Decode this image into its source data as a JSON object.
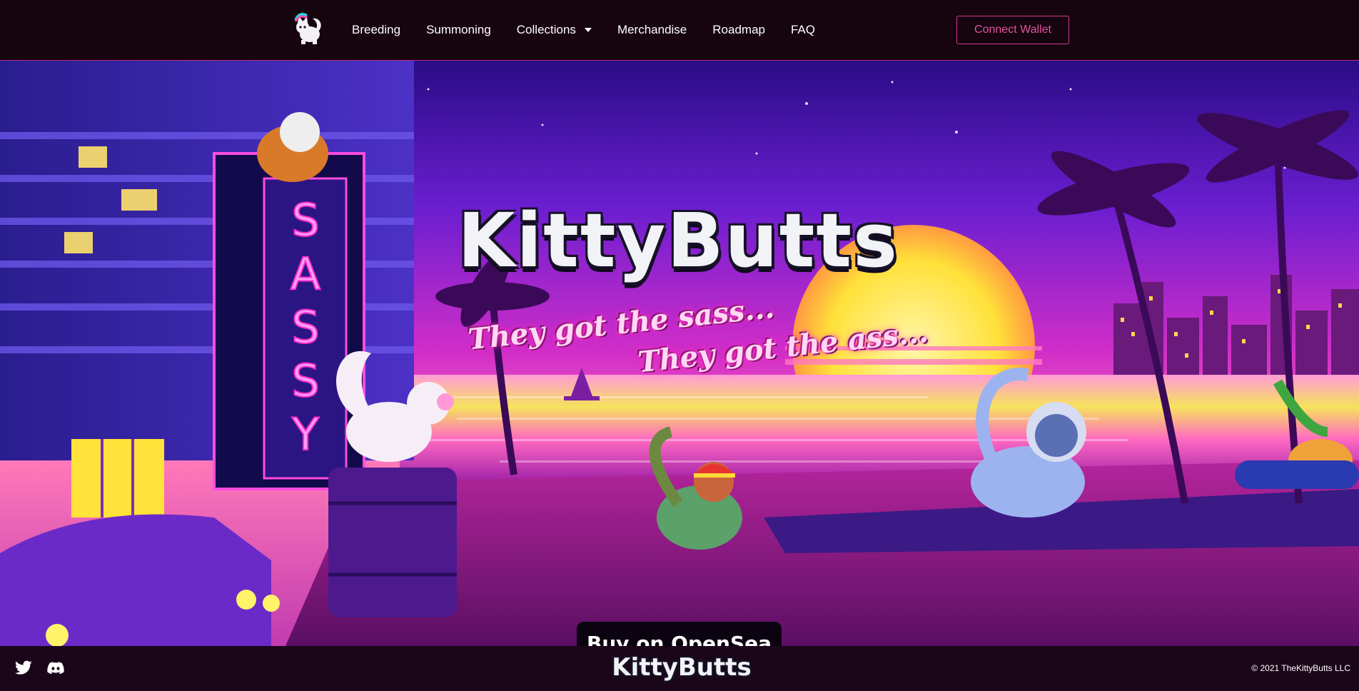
{
  "nav": {
    "logo_icon": "kittybutts-cat-logo-icon",
    "items": [
      {
        "label": "Breeding"
      },
      {
        "label": "Summoning"
      },
      {
        "label": "Collections",
        "has_dropdown": true
      },
      {
        "label": "Merchandise"
      },
      {
        "label": "Roadmap"
      },
      {
        "label": "FAQ"
      }
    ],
    "connect_wallet": "Connect Wallet"
  },
  "hero": {
    "title": "KittyButts",
    "tagline_1": "They got the sass...",
    "tagline_2": "They got the ass...",
    "sign_text": "SASSY",
    "buy_button": "Buy on OpenSea"
  },
  "footer": {
    "social_icons": [
      "twitter-icon",
      "discord-icon"
    ],
    "brand": "KittyButts",
    "copyright": "© 2021 TheKittyButts LLC"
  },
  "colors": {
    "nav_bg": "#16040f",
    "accent_pink": "#e0559f",
    "footer_bg": "#1b0619",
    "sky_top": "#3b0f9a",
    "sun": "#ffe94a"
  }
}
